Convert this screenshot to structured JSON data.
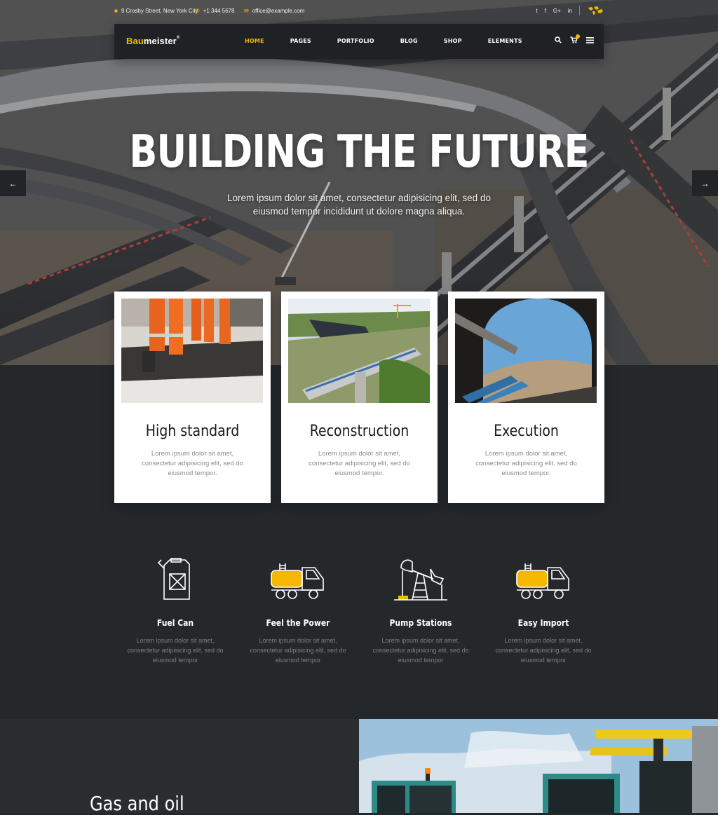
{
  "topbar": {
    "address": "9 Crosby Street, New York City",
    "phone": "+1 344 5678",
    "email": "office@example.com",
    "social": [
      "twitter-icon",
      "facebook-icon",
      "google-plus-icon",
      "linkedin-icon"
    ],
    "social_labels": [
      "t",
      "f",
      "G+",
      "in"
    ]
  },
  "brand": {
    "name_bold": "Bau",
    "name_rest": "meister",
    "mark": "®"
  },
  "menu": [
    "HOME",
    "PAGES",
    "PORTFOLIO",
    "BLOG",
    "SHOP",
    "ELEMENTS"
  ],
  "menu_active": "HOME",
  "hero": {
    "title": "BUILDING THE FUTURE",
    "subtitle": "Lorem ipsum dolor sit amet, consectetur adipisicing elit, sed do eiusmod tempor incididunt ut dolore magna aliqua.",
    "prev_arrow": "←",
    "next_arrow": "→"
  },
  "cards": [
    {
      "title": "High standard",
      "text": "Lorem ipsum dolor sit amet, consectetur adipisicing elit, sed do eiusmod tempor."
    },
    {
      "title": "Reconstruction",
      "text": "Lorem ipsum dolor sit amet, consectetur adipisicing elit, sed do eiusmod tempor."
    },
    {
      "title": "Execution",
      "text": "Lorem ipsum dolor sit amet, consectetur adipisicing elit, sed do eiusmod tempor."
    }
  ],
  "features": [
    {
      "icon": "fuel-can-icon",
      "title": "Fuel Can",
      "text": "Lorem ipsum dolor sit amet, consectetur adipisicing elit, sed do eiusmod tempor"
    },
    {
      "icon": "tanker-truck-icon",
      "title": "Feel the Power",
      "text": "Lorem ipsum dolor sit amet, consectetur adipisicing elit, sed do eiusmod tempor"
    },
    {
      "icon": "pump-jack-icon",
      "title": "Pump Stations",
      "text": "Lorem ipsum dolor sit amet, consectetur adipisicing elit, sed do eiusmod tempor"
    },
    {
      "icon": "tanker-truck-icon",
      "title": "Easy Import",
      "text": "Lorem ipsum dolor sit amet, consectetur adipisicing elit, sed do eiusmod tempor"
    }
  ],
  "section": {
    "title": "Gas and oil"
  },
  "colors": {
    "accent": "#f5b800",
    "dark_bg": "#25282b",
    "nav_bg": "#1f2124"
  }
}
